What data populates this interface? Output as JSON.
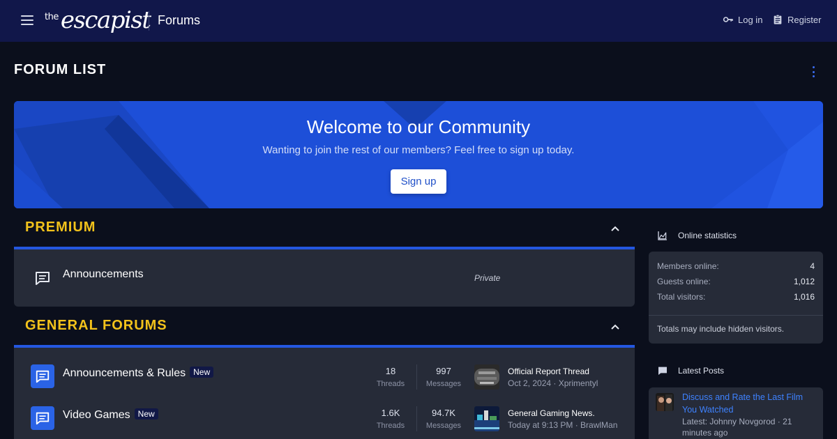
{
  "header": {
    "logo_prefix": "the",
    "logo_word": "escapist",
    "section": "Forums",
    "login": "Log in",
    "register": "Register"
  },
  "page": {
    "title": "FORUM LIST"
  },
  "banner": {
    "title": "Welcome to our Community",
    "subtitle": "Wanting to join the rest of our members? Feel free to sign up today.",
    "button": "Sign up"
  },
  "categories": [
    {
      "title": "PREMIUM",
      "nodes": [
        {
          "title": "Announcements",
          "status": "Private"
        }
      ]
    },
    {
      "title": "GENERAL FORUMS",
      "nodes": [
        {
          "title": "Announcements & Rules",
          "badge": "New",
          "threads": "18",
          "threads_label": "Threads",
          "messages": "997",
          "messages_label": "Messages",
          "last_title": "Official Report Thread",
          "last_meta": "Oct 2, 2024 · Xprimentyl"
        },
        {
          "title": "Video Games",
          "badge": "New",
          "threads": "1.6K",
          "threads_label": "Threads",
          "messages": "94.7K",
          "messages_label": "Messages",
          "last_title": "General Gaming News.",
          "last_meta": "Today at 9:13 PM · BrawlMan"
        }
      ]
    }
  ],
  "sidebar": {
    "online": {
      "title": "Online statistics",
      "rows": [
        {
          "label": "Members online:",
          "value": "4"
        },
        {
          "label": "Guests online:",
          "value": "1,012"
        },
        {
          "label": "Total visitors:",
          "value": "1,016"
        }
      ],
      "note": "Totals may include hidden visitors."
    },
    "latest": {
      "title": "Latest Posts",
      "items": [
        {
          "title": "Discuss and Rate the Last Film You Watched",
          "meta": "Latest: Johnny Novgorod · 21 minutes ago"
        }
      ]
    }
  },
  "colors": {
    "header_bg": "#11174a",
    "page_bg": "#0b0f1c",
    "accent_blue": "#2457e0",
    "category_gold": "#f2c21b",
    "panel_bg": "#262b38",
    "link_blue": "#3e82ff"
  },
  "icons": {
    "menu": "hamburger-icon",
    "login": "key-icon",
    "register": "clipboard-icon",
    "more": "vertical-ellipsis-icon",
    "collapse": "chevron-up-icon",
    "forum": "chat-bubble-icon",
    "stats": "area-chart-icon",
    "latest": "comment-icon"
  }
}
